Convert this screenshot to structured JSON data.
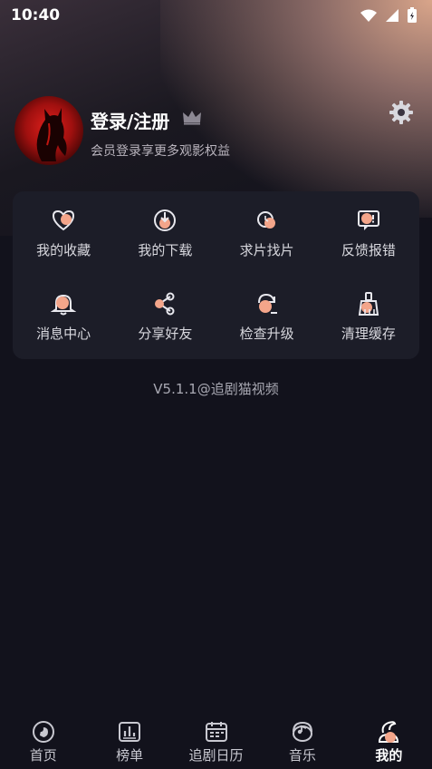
{
  "status_bar": {
    "time": "10:40"
  },
  "profile": {
    "title": "登录/注册",
    "subtitle": "会员登录享更多观影权益"
  },
  "grid": {
    "items": [
      {
        "label": "我的收藏",
        "icon": "heart-icon"
      },
      {
        "label": "我的下载",
        "icon": "download-icon"
      },
      {
        "label": "求片找片",
        "icon": "search-film-icon"
      },
      {
        "label": "反馈报错",
        "icon": "feedback-icon"
      },
      {
        "label": "消息中心",
        "icon": "bell-icon"
      },
      {
        "label": "分享好友",
        "icon": "share-icon"
      },
      {
        "label": "检查升级",
        "icon": "refresh-icon"
      },
      {
        "label": "清理缓存",
        "icon": "broom-icon"
      }
    ]
  },
  "version": "V5.1.1@追剧猫视频",
  "tabbar": {
    "tabs": [
      {
        "label": "首页",
        "icon": "home-icon"
      },
      {
        "label": "榜单",
        "icon": "ranking-icon"
      },
      {
        "label": "追剧日历",
        "icon": "calendar-icon"
      },
      {
        "label": "音乐",
        "icon": "music-icon"
      },
      {
        "label": "我的",
        "icon": "profile-icon"
      }
    ],
    "active": "我的"
  },
  "colors": {
    "accent": "#f3a58a",
    "background": "#12121c",
    "card": "#1c1d28"
  }
}
